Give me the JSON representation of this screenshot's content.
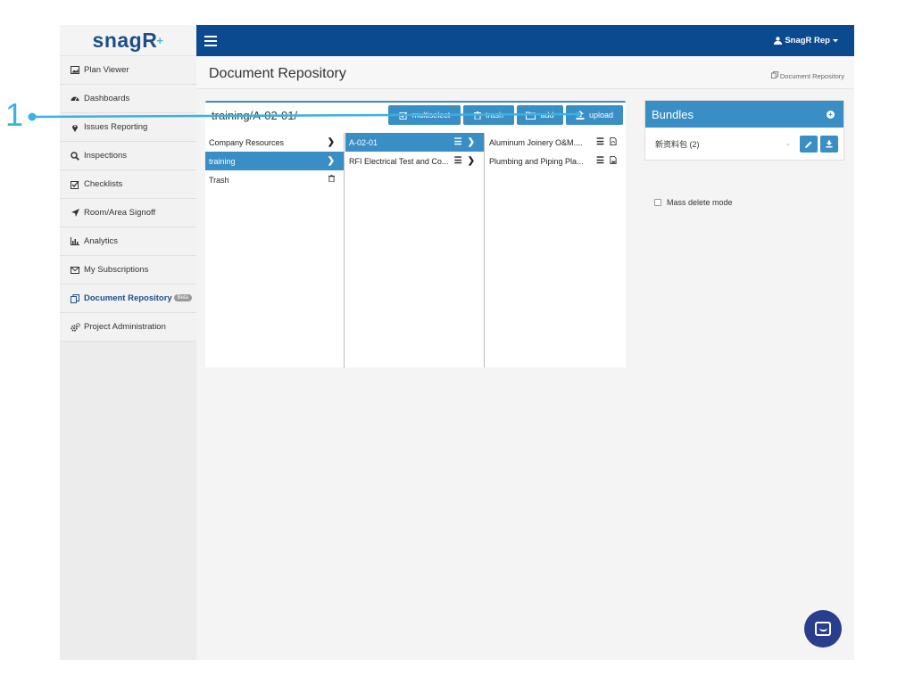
{
  "sidebar": {
    "brand_main": "snagR",
    "brand_mark": "+",
    "items": [
      {
        "label": "Plan Viewer",
        "icon": "image-icon"
      },
      {
        "label": "Dashboards",
        "icon": "dashboard-icon"
      },
      {
        "label": "Issues Reporting",
        "icon": "map-marker-icon"
      },
      {
        "label": "Inspections",
        "icon": "search-icon"
      },
      {
        "label": "Checklists",
        "icon": "checkbox-icon"
      },
      {
        "label": "Room/Area Signoff",
        "icon": "location-arrow-icon"
      },
      {
        "label": "Analytics",
        "icon": "bar-chart-icon"
      },
      {
        "label": "My Subscriptions",
        "icon": "envelope-icon"
      },
      {
        "label": "Document Repository",
        "icon": "copy-icon",
        "active": true,
        "badge": "Beta"
      },
      {
        "label": "Project Administration",
        "icon": "cogs-icon"
      }
    ]
  },
  "topbar": {
    "user": "SnagR Rep"
  },
  "page": {
    "title": "Document Repository",
    "breadcrumb": "Document Repository"
  },
  "repo": {
    "path": "training/A-02-01/",
    "toolbar": {
      "multiselect": "multiselect",
      "trash": "trash",
      "add": "add",
      "upload": "upload"
    },
    "col1": [
      "Company Resources",
      "training",
      "Trash"
    ],
    "col2": [
      "A-02-01",
      "RFI Electrical Test and Co..."
    ],
    "col3": [
      "Aluminum Joinery O&M....",
      "Plumbing and Piping Pla..."
    ]
  },
  "bundles": {
    "title": "Bundles",
    "item": "新资料包 (2)",
    "mass_delete": "Mass delete mode"
  },
  "callout": {
    "number": "1"
  },
  "colors": {
    "brand": "#0b4a8e",
    "accent": "#3a8ec6",
    "callout": "#3ab2e1",
    "chat": "#2a3e8e"
  }
}
